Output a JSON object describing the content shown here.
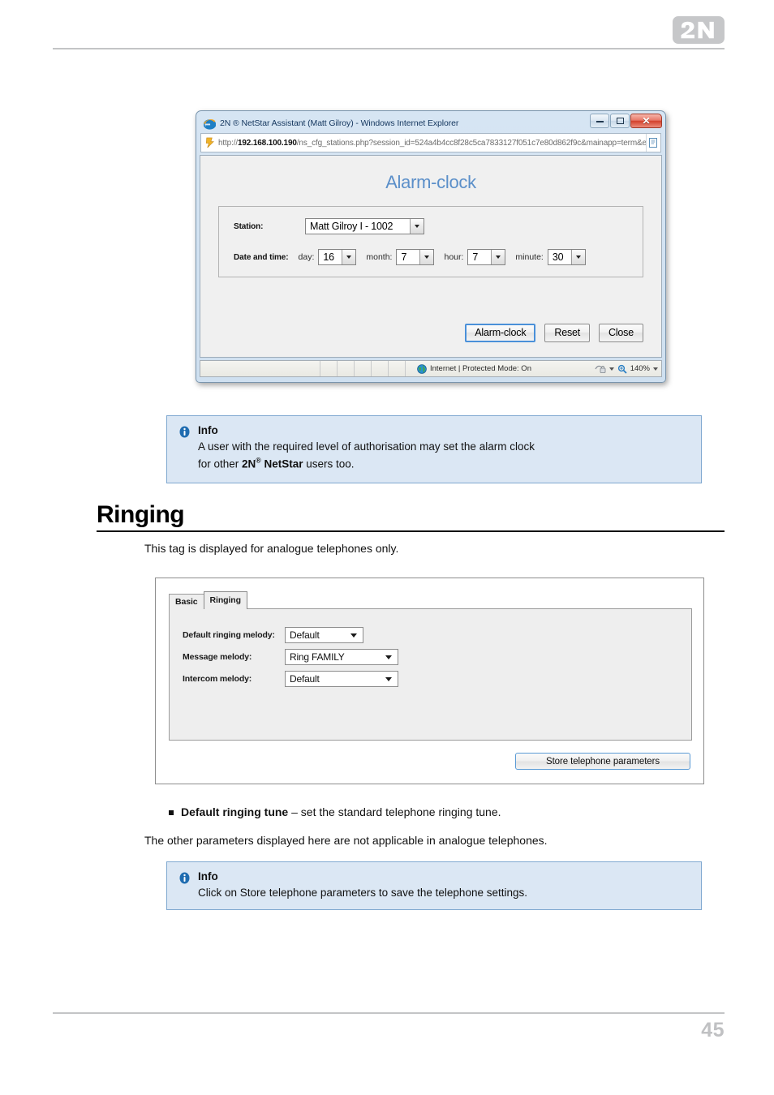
{
  "page": {
    "logo_text": "2N",
    "page_number": "45"
  },
  "figure_browser": {
    "title": "2N ® NetStar Assistant (Matt Gilroy) - Windows Internet Explorer",
    "window_buttons": {
      "minimize": "minimize-button",
      "maximize": "maximize-button",
      "close": "✕"
    },
    "address": {
      "scheme": "http://",
      "host": "192.168.100.190",
      "path": "/ns_cfg_stations.php?session_id=524a4b4cc8f28c5ca7833127f051c7e80d862f9c&mainapp=term&expands",
      "go_icon": "page-icon"
    },
    "content": {
      "heading": "Alarm-clock",
      "station_label": "Station:",
      "station_value": "Matt Gilroy I - 1002",
      "datetime_label": "Date and time:",
      "fields": [
        {
          "label": "day:",
          "value": "16"
        },
        {
          "label": "month:",
          "value": "7"
        },
        {
          "label": "hour:",
          "value": "7"
        },
        {
          "label": "minute:",
          "value": "30"
        }
      ],
      "buttons": [
        {
          "label": "Alarm-clock",
          "default": true
        },
        {
          "label": "Reset",
          "default": false
        },
        {
          "label": "Close",
          "default": false
        }
      ]
    },
    "statusbar": {
      "zone_text": "Internet | Protected Mode: On",
      "zoom_level": "140%"
    }
  },
  "info_box_1": {
    "title": "Info",
    "line1": "A user with the required level of authorisation may set the alarm clock",
    "line2_pre": "for other ",
    "line2_brand": "2N",
    "line2_brand_sup": "®",
    "line2_brand2": " NetStar",
    "line2_post": " users too."
  },
  "section": {
    "heading": "Ringing",
    "intro": "This tag is displayed for analogue telephones only.",
    "bullet_bold": "Default ringing tune",
    "bullet_rest": " – set the standard telephone ringing tune.",
    "other_params": "The other parameters displayed here are not applicable in analogue telephones."
  },
  "figure_ringing": {
    "tabs": [
      {
        "label": "Basic",
        "active": false
      },
      {
        "label": "Ringing",
        "active": true
      }
    ],
    "rows": [
      {
        "label": "Default ringing melody:",
        "value": "Default"
      },
      {
        "label": "Message melody:",
        "value": "Ring FAMILY"
      },
      {
        "label": "Intercom melody:",
        "value": "Default"
      }
    ],
    "store_button": "Store telephone parameters"
  },
  "info_box_2": {
    "title": "Info",
    "line1": "Click on Store telephone parameters to save the telephone settings."
  }
}
